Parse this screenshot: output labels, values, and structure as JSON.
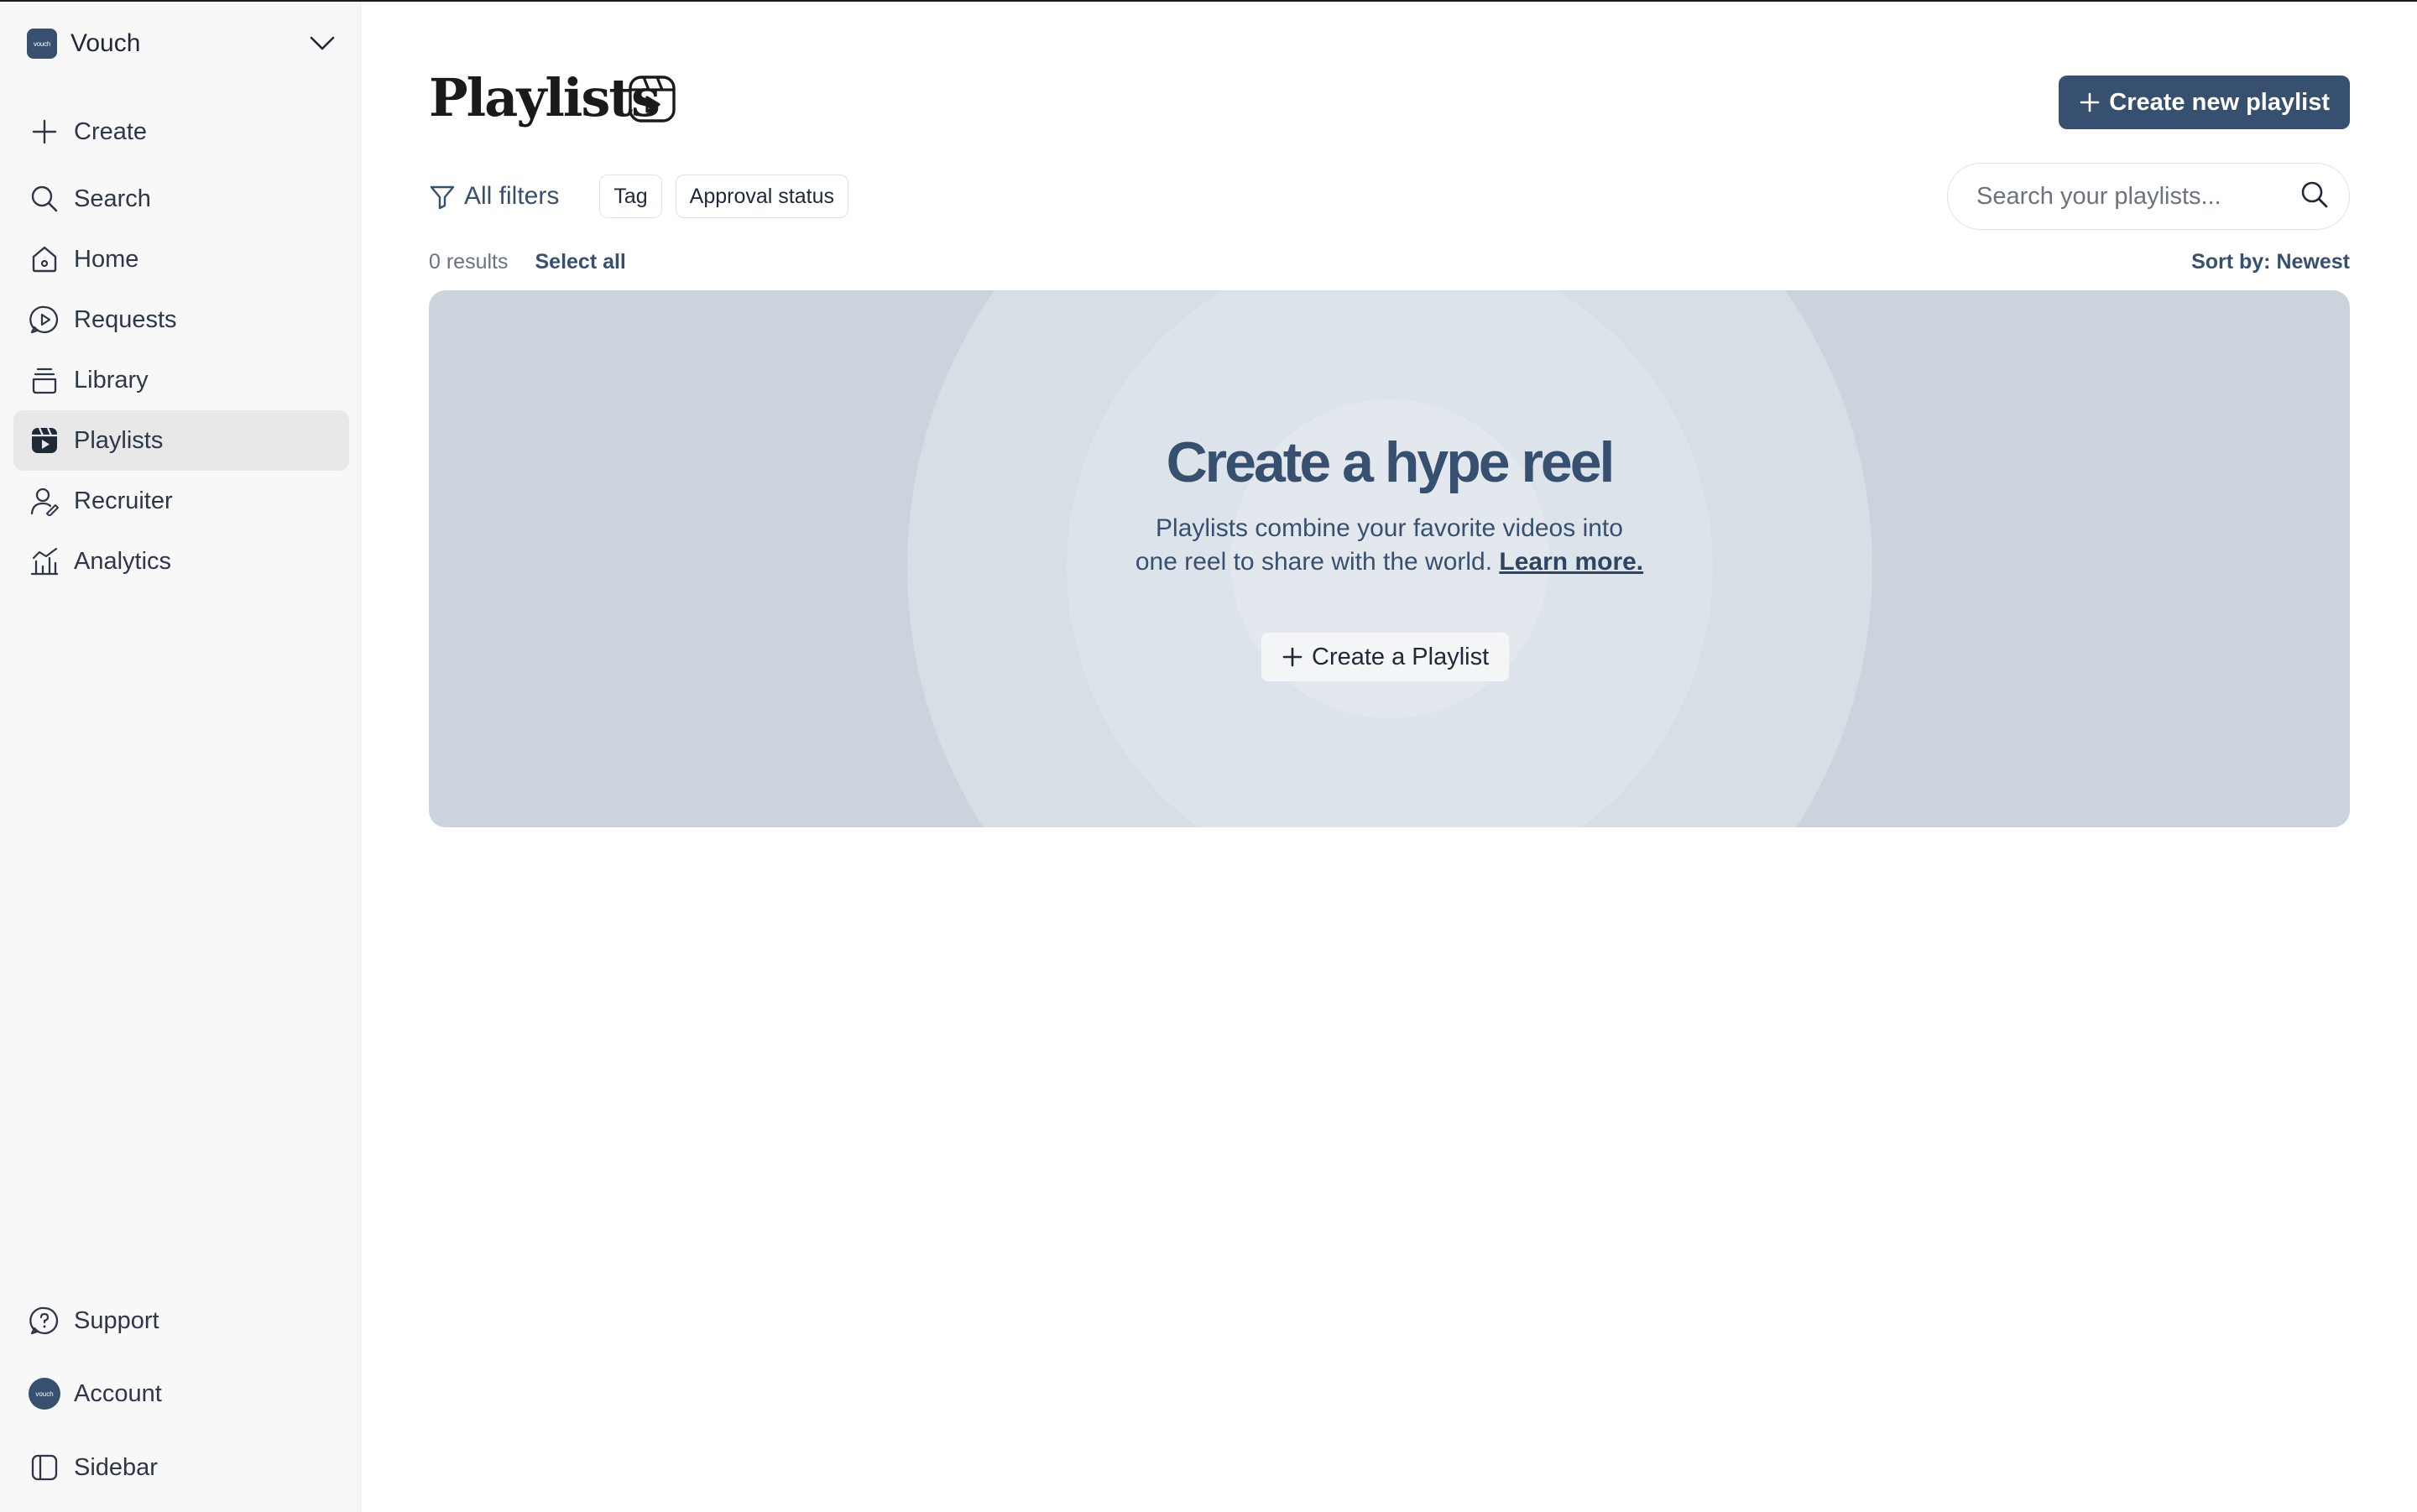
{
  "workspace": {
    "logo_text": "vouch",
    "name": "Vouch"
  },
  "sidebar": {
    "items": [
      {
        "label": "Create",
        "icon": "plus-icon"
      },
      {
        "label": "Search",
        "icon": "search-icon"
      },
      {
        "label": "Home",
        "icon": "home-icon"
      },
      {
        "label": "Requests",
        "icon": "requests-icon"
      },
      {
        "label": "Library",
        "icon": "library-icon"
      },
      {
        "label": "Playlists",
        "icon": "playlist-icon",
        "active": true
      },
      {
        "label": "Recruiter",
        "icon": "recruiter-icon"
      },
      {
        "label": "Analytics",
        "icon": "analytics-icon"
      }
    ],
    "footer": [
      {
        "label": "Support",
        "icon": "help-icon"
      },
      {
        "label": "Account",
        "icon": "avatar"
      },
      {
        "label": "Sidebar",
        "icon": "sidebar-toggle-icon"
      }
    ]
  },
  "main": {
    "title": "Playlists",
    "create_button": "Create new playlist",
    "filters": {
      "all_filters": "All filters",
      "chips": [
        "Tag",
        "Approval status"
      ]
    },
    "search": {
      "placeholder": "Search your playlists..."
    },
    "results": {
      "count": "0 results",
      "select_all": "Select all",
      "sort": "Sort by: Newest"
    },
    "empty_state": {
      "title": "Create a hype reel",
      "text_line1": "Playlists combine your favorite videos into",
      "text_line2": "one reel to share with the world.",
      "learn_more": "Learn more.",
      "button": "Create a Playlist"
    }
  },
  "colors": {
    "accent": "#37506f",
    "hero_bg": "#cbd4dd",
    "sidebar_bg": "#f8f8f8",
    "active_item_bg": "#e8e8e8"
  }
}
